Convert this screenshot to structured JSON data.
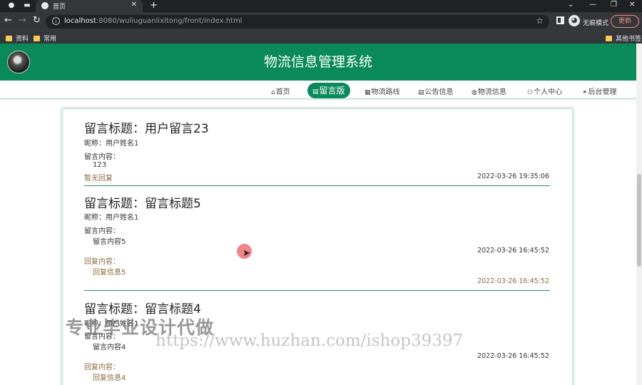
{
  "browser": {
    "tab_title": "首页",
    "new_tab": "+",
    "url_host": "localhost",
    "url_rest": ":8080/wuliuguanlixitong/front/index.html",
    "profile_label": "无痕模式",
    "update_label": "更新",
    "bookmarks": [
      "资料",
      "常用"
    ],
    "other_bookmarks": "其他书签"
  },
  "site": {
    "title": "物流信息管理系统"
  },
  "nav": {
    "items": [
      {
        "icon": "⌂",
        "label": "首页"
      },
      {
        "icon": "▤",
        "label": "留言版"
      },
      {
        "icon": "▦",
        "label": "物流路线"
      },
      {
        "icon": "▤",
        "label": "公告信息"
      },
      {
        "icon": "◍",
        "label": "物流信息"
      },
      {
        "icon": "⚇",
        "label": "个人中心"
      },
      {
        "icon": "⚭",
        "label": "后台管理"
      }
    ],
    "active_index": 1
  },
  "messages": [
    {
      "title": "留言标题：用户留言23",
      "nickname": "昵称：用户姓名1",
      "content_label": "留言内容：",
      "content": "123",
      "reply_label": "暂无回复",
      "time": "2022-03-26 19:35:06"
    },
    {
      "title": "留言标题：留言标题5",
      "nickname": "昵称：用户姓名1",
      "content_label": "留言内容：",
      "content": "留言内容5",
      "time": "2022-03-26 16:45:52",
      "reply_label": "回复内容：",
      "reply": "回复信息5",
      "reply_time": "2022-03-26 16:45:52"
    },
    {
      "title": "留言标题：留言标题4",
      "nickname": "昵称：用户姓名1",
      "content_label": "留言内容：",
      "content": "留言内容4",
      "time": "2022-03-26 16:45:52",
      "reply_label": "回复内容：",
      "reply": "回复信息4"
    }
  ],
  "watermark": {
    "cn": "专业毕业设计代做",
    "url": "https://www.huzhan.com/ishop39397"
  }
}
